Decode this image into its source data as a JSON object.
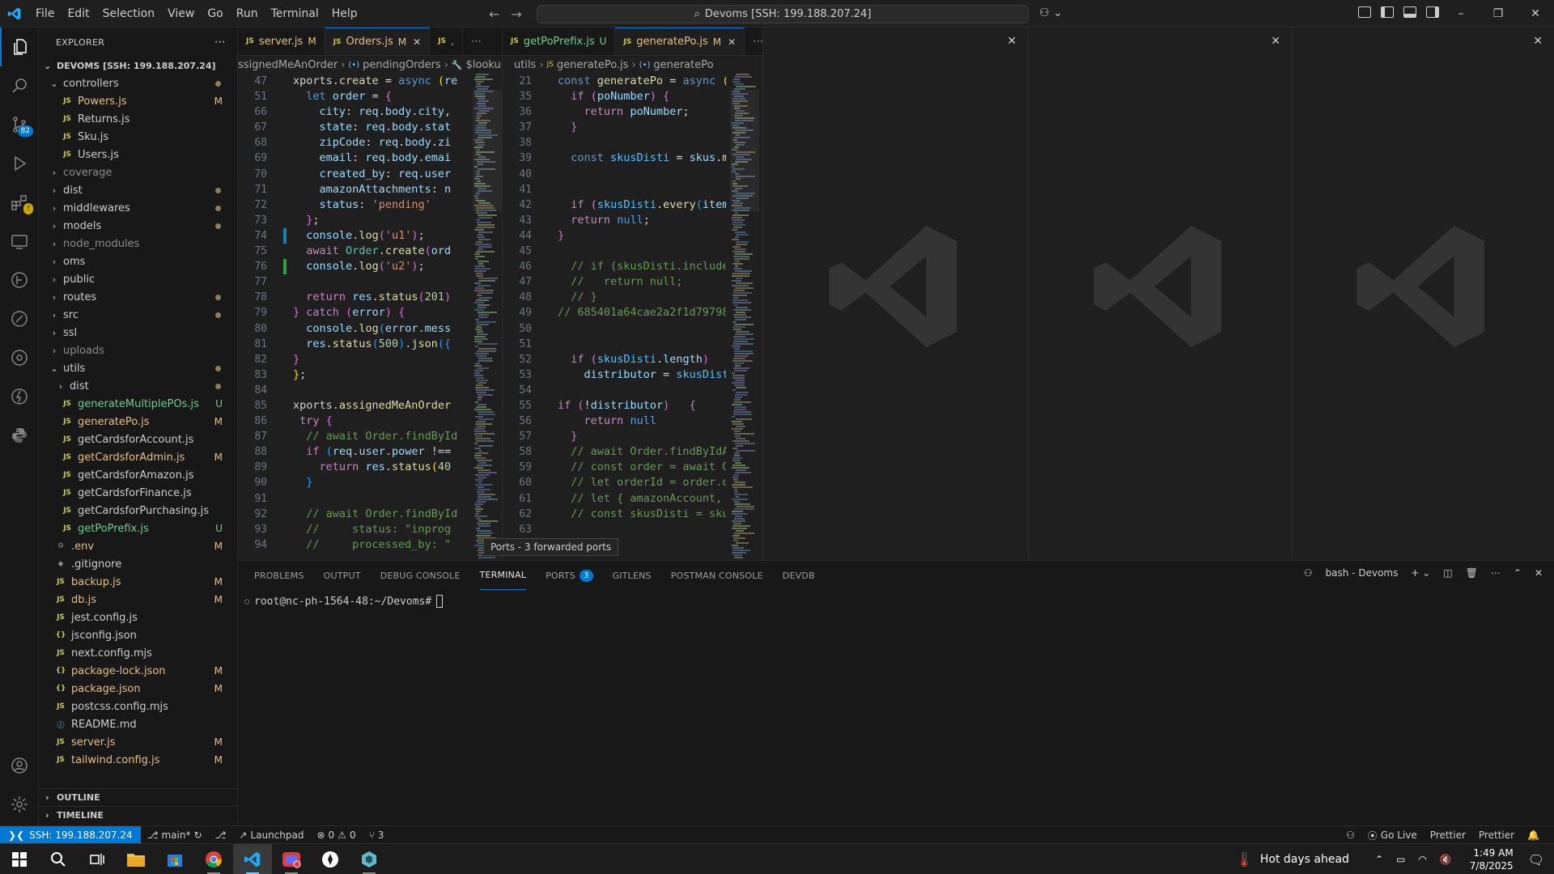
{
  "titlebar": {
    "menu": [
      "File",
      "Edit",
      "Selection",
      "View",
      "Go",
      "Run",
      "Terminal",
      "Help"
    ],
    "search_text": "Devoms [SSH: 199.188.207.24]"
  },
  "sidebar": {
    "header": "EXPLORER",
    "workspace": "DEVOMS [SSH: 199.188.207.24]",
    "items": [
      {
        "label": "controllers",
        "type": "folder-open",
        "indent": 1,
        "dot": true
      },
      {
        "label": "Powers.js",
        "type": "js",
        "indent": 2,
        "status": "M"
      },
      {
        "label": "Returns.js",
        "type": "js",
        "indent": 2
      },
      {
        "label": "Sku.js",
        "type": "js",
        "indent": 2
      },
      {
        "label": "Users.js",
        "type": "js",
        "indent": 2
      },
      {
        "label": "coverage",
        "type": "folder",
        "indent": 1,
        "ignored": true
      },
      {
        "label": "dist",
        "type": "folder",
        "indent": 1,
        "dot": true
      },
      {
        "label": "middlewares",
        "type": "folder",
        "indent": 1,
        "dot": true
      },
      {
        "label": "models",
        "type": "folder",
        "indent": 1,
        "dot": true
      },
      {
        "label": "node_modules",
        "type": "folder",
        "indent": 1,
        "ignored": true
      },
      {
        "label": "oms",
        "type": "folder",
        "indent": 1
      },
      {
        "label": "public",
        "type": "folder",
        "indent": 1
      },
      {
        "label": "routes",
        "type": "folder",
        "indent": 1,
        "dot": true
      },
      {
        "label": "src",
        "type": "folder",
        "indent": 1,
        "dot": true
      },
      {
        "label": "ssl",
        "type": "folder",
        "indent": 1
      },
      {
        "label": "uploads",
        "type": "folder",
        "indent": 1,
        "ignored": true
      },
      {
        "label": "utils",
        "type": "folder-open",
        "indent": 1,
        "dot": true
      },
      {
        "label": "dist",
        "type": "folder",
        "indent": 2,
        "dot": true
      },
      {
        "label": "generateMultiplePOs.js",
        "type": "js",
        "indent": 2,
        "status": "U"
      },
      {
        "label": "generatePo.js",
        "type": "js",
        "indent": 2,
        "status": "M"
      },
      {
        "label": "getCardsforAccount.js",
        "type": "js",
        "indent": 2
      },
      {
        "label": "getCardsforAdmin.js",
        "type": "js",
        "indent": 2,
        "status": "M"
      },
      {
        "label": "getCardsforAmazon.js",
        "type": "js",
        "indent": 2
      },
      {
        "label": "getCardsforFinance.js",
        "type": "js",
        "indent": 2
      },
      {
        "label": "getCardsforPurchasing.js",
        "type": "js",
        "indent": 2
      },
      {
        "label": "getPoPrefix.js",
        "type": "js",
        "indent": 2,
        "status": "U"
      },
      {
        "label": ".env",
        "type": "gear",
        "indent": 1,
        "status": "M"
      },
      {
        "label": ".gitignore",
        "type": "git",
        "indent": 1
      },
      {
        "label": "backup.js",
        "type": "js",
        "indent": 1,
        "status": "M"
      },
      {
        "label": "db.js",
        "type": "js",
        "indent": 1,
        "status": "M"
      },
      {
        "label": "jest.config.js",
        "type": "js",
        "indent": 1
      },
      {
        "label": "jsconfig.json",
        "type": "json",
        "indent": 1
      },
      {
        "label": "next.config.mjs",
        "type": "js",
        "indent": 1
      },
      {
        "label": "package-lock.json",
        "type": "json",
        "indent": 1,
        "status": "M"
      },
      {
        "label": "package.json",
        "type": "json",
        "indent": 1,
        "status": "M"
      },
      {
        "label": "postcss.config.mjs",
        "type": "js",
        "indent": 1
      },
      {
        "label": "README.md",
        "type": "info",
        "indent": 1
      },
      {
        "label": "server.js",
        "type": "js",
        "indent": 1,
        "status": "M"
      },
      {
        "label": "tailwind.config.js",
        "type": "js",
        "indent": 1,
        "status": "M"
      }
    ],
    "outline": "OUTLINE",
    "timeline": "TIMELINE"
  },
  "editor1": {
    "tabs": [
      {
        "label": "server.js",
        "status": "M"
      },
      {
        "label": "Orders.js",
        "status": "M",
        "active": true
      },
      {
        "label": ",",
        "status": ""
      }
    ],
    "breadcrumb": [
      "ssignedMeAnOrder",
      "pendingOrders",
      "$lookup"
    ],
    "lines": [
      {
        "n": "47",
        "html": "<span class='pl'>xports.</span><span class='fn'>create</span><span class='pl'> = </span><span class='kw'>async</span><span class='pl'> </span><span class='br'>(</span><span class='vr'>re</span>",
        "gut": ""
      },
      {
        "n": "51",
        "html": "<span class='pl'>  </span><span class='kw'>let</span><span class='pl'> </span><span class='vr'>order</span><span class='pl'> = </span><span class='br2'>{</span>",
        "gut": ""
      },
      {
        "n": "66",
        "html": "<span class='pl'>    </span><span class='vr'>city</span><span class='pl'>: </span><span class='vr'>req</span><span class='pl'>.</span><span class='vr'>body</span><span class='pl'>.</span><span class='vr'>city</span><span class='pl'>,</span>",
        "gut": ""
      },
      {
        "n": "67",
        "html": "<span class='pl'>    </span><span class='vr'>state</span><span class='pl'>: </span><span class='vr'>req</span><span class='pl'>.</span><span class='vr'>body</span><span class='pl'>.</span><span class='vr'>stat</span>",
        "gut": ""
      },
      {
        "n": "68",
        "html": "<span class='pl'>    </span><span class='vr'>zipCode</span><span class='pl'>: </span><span class='vr'>req</span><span class='pl'>.</span><span class='vr'>body</span><span class='pl'>.</span><span class='vr'>zi</span>",
        "gut": ""
      },
      {
        "n": "69",
        "html": "<span class='pl'>    </span><span class='vr'>email</span><span class='pl'>: </span><span class='vr'>req</span><span class='pl'>.</span><span class='vr'>body</span><span class='pl'>.</span><span class='vr'>emai</span>",
        "gut": ""
      },
      {
        "n": "70",
        "html": "<span class='pl'>    </span><span class='vr'>created_by</span><span class='pl'>: </span><span class='vr'>req</span><span class='pl'>.</span><span class='vr'>user</span>",
        "gut": ""
      },
      {
        "n": "71",
        "html": "<span class='pl'>    </span><span class='vr'>amazonAttachments</span><span class='pl'>: </span><span class='vr'>n</span>",
        "gut": ""
      },
      {
        "n": "72",
        "html": "<span class='pl'>    </span><span class='vr'>status</span><span class='pl'>: </span><span class='str'>'pending'</span>",
        "gut": ""
      },
      {
        "n": "73",
        "html": "<span class='pl'>  </span><span class='br2'>}</span><span class='pl'>;</span>",
        "gut": ""
      },
      {
        "n": "74",
        "html": "<span class='pl'>  </span><span class='vr'>console</span><span class='pl'>.</span><span class='fn'>log</span><span class='br2'>(</span><span class='str'>'u1'</span><span class='br2'>)</span><span class='pl'>;</span>",
        "gut": "b"
      },
      {
        "n": "75",
        "html": "<span class='pl'>  </span><span class='kw2'>await</span><span class='pl'> </span><span class='ty'>Order</span><span class='pl'>.</span><span class='fn'>create</span><span class='br2'>(</span><span class='vr'>ord</span>",
        "gut": ""
      },
      {
        "n": "76",
        "html": "<span class='pl'>  </span><span class='vr'>console</span><span class='pl'>.</span><span class='fn'>log</span><span class='br2'>(</span><span class='str'>'u2'</span><span class='br2'>)</span><span class='pl'>;</span>",
        "gut": "g"
      },
      {
        "n": "77",
        "html": "",
        "gut": ""
      },
      {
        "n": "78",
        "html": "<span class='pl'>  </span><span class='kw2'>return</span><span class='pl'> </span><span class='vr'>res</span><span class='pl'>.</span><span class='fn'>status</span><span class='br2'>(</span><span class='num'>201</span><span class='br2'>)</span>",
        "gut": ""
      },
      {
        "n": "79",
        "html": "<span class='br2'>}</span><span class='pl'> </span><span class='kw2'>catch</span><span class='pl'> </span><span class='br2'>(</span><span class='vr'>error</span><span class='br2'>)</span><span class='pl'> </span><span class='br2'>{</span>",
        "gut": ""
      },
      {
        "n": "80",
        "html": "<span class='pl'>  </span><span class='vr'>console</span><span class='pl'>.</span><span class='fn'>log</span><span class='br3'>(</span><span class='vr'>error</span><span class='pl'>.</span><span class='vr'>mess</span>",
        "gut": ""
      },
      {
        "n": "81",
        "html": "<span class='pl'>  </span><span class='vr'>res</span><span class='pl'>.</span><span class='fn'>status</span><span class='br3'>(</span><span class='num'>500</span><span class='br3'>)</span><span class='pl'>.</span><span class='fn'>json</span><span class='br3'>({</span>",
        "gut": ""
      },
      {
        "n": "82",
        "html": "<span class='br2'>}</span>",
        "gut": ""
      },
      {
        "n": "83",
        "html": "<span class='br'>}</span><span class='pl'>;</span>",
        "gut": ""
      },
      {
        "n": "84",
        "html": "",
        "gut": ""
      },
      {
        "n": "85",
        "html": "<span class='pl'>xports.</span><span class='fn'>assignedMeAnOrder</span>",
        "gut": ""
      },
      {
        "n": "86",
        "html": "<span class='pl'> </span><span class='kw2'>try</span><span class='pl'> </span><span class='br2'>{</span>",
        "gut": ""
      },
      {
        "n": "87",
        "html": "<span class='pl'>  </span><span class='cm'>// await Order.findById</span>",
        "gut": ""
      },
      {
        "n": "88",
        "html": "<span class='pl'>  </span><span class='kw2'>if</span><span class='pl'> </span><span class='br3'>(</span><span class='vr'>req</span><span class='pl'>.</span><span class='vr'>user</span><span class='pl'>.</span><span class='vr'>power</span><span class='pl'> !==</span>",
        "gut": ""
      },
      {
        "n": "89",
        "html": "<span class='pl'>    </span><span class='kw2'>return</span><span class='pl'> </span><span class='vr'>res</span><span class='pl'>.</span><span class='fn'>status</span><span class='br'>(</span><span class='num'>40</span>",
        "gut": ""
      },
      {
        "n": "90",
        "html": "<span class='pl'>  </span><span class='br3'>}</span>",
        "gut": ""
      },
      {
        "n": "91",
        "html": "",
        "gut": ""
      },
      {
        "n": "92",
        "html": "<span class='pl'>  </span><span class='cm'>// await Order.findById</span>",
        "gut": ""
      },
      {
        "n": "93",
        "html": "<span class='pl'>  </span><span class='cm'>//     status: \"inprog</span>",
        "gut": ""
      },
      {
        "n": "94",
        "html": "<span class='pl'>  </span><span class='cm'>//     processed_by: \"</span>",
        "gut": ""
      }
    ]
  },
  "editor2": {
    "tabs": [
      {
        "label": "getPoPrefix.js",
        "status": "U"
      },
      {
        "label": "generatePo.js",
        "status": "M",
        "active": true
      }
    ],
    "breadcrumb": [
      "utils",
      "generatePo.js",
      "generatePo"
    ],
    "lines": [
      {
        "n": "21",
        "html": "<span class='kw'>const</span><span class='pl'> </span><span class='fn'>generatePo</span><span class='pl'> = </span><span class='kw'>async</span><span class='pl'> </span><span class='br'>(</span><span class='vr'>c</span>",
        "gut": ""
      },
      {
        "n": "35",
        "html": "<span class='pl'>  </span><span class='kw2'>if</span><span class='pl'> </span><span class='br2'>(</span><span class='vr'>poNumber</span><span class='br2'>)</span><span class='pl'> </span><span class='br2'>{</span>",
        "gut": ""
      },
      {
        "n": "36",
        "html": "<span class='pl'>    </span><span class='kw2'>return</span><span class='pl'> </span><span class='vr'>poNumber</span><span class='pl'>;</span>",
        "gut": ""
      },
      {
        "n": "37",
        "html": "<span class='pl'>  </span><span class='br2'>}</span>",
        "gut": ""
      },
      {
        "n": "38",
        "html": "",
        "gut": ""
      },
      {
        "n": "39",
        "html": "<span class='pl'>  </span><span class='kw'>const</span><span class='pl'> </span><span class='cn'>skusDisti</span><span class='pl'> = </span><span class='vr'>skus</span><span class='pl'>.</span><span class='fn'>ma</span>",
        "gut": ""
      },
      {
        "n": "40",
        "html": "",
        "gut": ""
      },
      {
        "n": "41",
        "html": "",
        "gut": ""
      },
      {
        "n": "42",
        "html": "<span class='pl'>  </span><span class='kw2'>if</span><span class='pl'> </span><span class='br2'>(</span><span class='cn'>skusDisti</span><span class='pl'>.</span><span class='fn'>every</span><span class='br3'>(</span><span class='vr'>item</span>",
        "gut": ""
      },
      {
        "n": "43",
        "html": "<span class='pl'>  </span><span class='kw2'>return</span><span class='pl'> </span><span class='kw'>null</span><span class='pl'>;</span>",
        "gut": ""
      },
      {
        "n": "44",
        "html": "<span class='br2'>}</span>",
        "gut": ""
      },
      {
        "n": "45",
        "html": "",
        "gut": ""
      },
      {
        "n": "46",
        "html": "<span class='pl'>  </span><span class='cm'>// if (skusDisti.includes</span>",
        "gut": ""
      },
      {
        "n": "47",
        "html": "<span class='pl'>  </span><span class='cm'>//   return null;</span>",
        "gut": ""
      },
      {
        "n": "48",
        "html": "<span class='pl'>  </span><span class='cm'>// }</span>",
        "gut": ""
      },
      {
        "n": "49",
        "html": "<span class='cm'>// 685401a64cae2a2f1d79798</span>",
        "gut": ""
      },
      {
        "n": "50",
        "html": "",
        "gut": ""
      },
      {
        "n": "51",
        "html": "",
        "gut": ""
      },
      {
        "n": "52",
        "html": "<span class='pl'>  </span><span class='kw2'>if</span><span class='pl'> </span><span class='br2'>(</span><span class='cn'>skusDisti</span><span class='pl'>.</span><span class='vr'>length</span><span class='br2'>)</span>",
        "gut": ""
      },
      {
        "n": "53",
        "html": "<span class='pl'>    </span><span class='vr'>distributor</span><span class='pl'> = </span><span class='cn'>skusDisti</span>",
        "gut": ""
      },
      {
        "n": "54",
        "html": "",
        "gut": ""
      },
      {
        "n": "55",
        "html": "<span class='kw2'>if</span><span class='pl'> </span><span class='br2'>(</span><span class='pl'>!</span><span class='vr'>distributor</span><span class='br2'>)</span><span class='pl'>   </span><span class='br2'>{</span>",
        "gut": ""
      },
      {
        "n": "56",
        "html": "<span class='pl'>    </span><span class='kw2'>return</span><span class='pl'> </span><span class='kw'>null</span>",
        "gut": ""
      },
      {
        "n": "57",
        "html": "<span class='pl'>  </span><span class='br2'>}</span>",
        "gut": ""
      },
      {
        "n": "58",
        "html": "<span class='pl'>  </span><span class='cm'>// await Order.findByIdAn</span>",
        "gut": ""
      },
      {
        "n": "59",
        "html": "<span class='pl'>  </span><span class='cm'>// const order = await Or</span>",
        "gut": ""
      },
      {
        "n": "60",
        "html": "<span class='pl'>  </span><span class='cm'>// let orderId = order.or</span>",
        "gut": ""
      },
      {
        "n": "61",
        "html": "<span class='pl'>  </span><span class='cm'>// let { amazonAccount, s</span>",
        "gut": ""
      },
      {
        "n": "62",
        "html": "<span class='pl'>  </span><span class='cm'>// const skusDisti = skus</span>",
        "gut": ""
      },
      {
        "n": "63",
        "html": "",
        "gut": ""
      }
    ]
  },
  "tooltip": "Ports - 3 forwarded ports",
  "panel": {
    "tabs": [
      "PROBLEMS",
      "OUTPUT",
      "DEBUG CONSOLE",
      "TERMINAL",
      "PORTS",
      "GITLENS",
      "POSTMAN CONSOLE",
      "DEVDB"
    ],
    "active_tab": "TERMINAL",
    "ports_count": "3",
    "terminal_name": "bash - Devoms",
    "prompt": "root@nc-ph-1564-48:~/Devoms#"
  },
  "statusbar": {
    "remote": "SSH: 199.188.207.24",
    "branch": "main*",
    "launchpad": "Launchpad",
    "errors": "0",
    "warnings": "0",
    "ports": "3",
    "golive": "Go Live",
    "prettier1": "Prettier",
    "prettier2": "Prettier"
  },
  "taskbar": {
    "weather": "Hot days ahead",
    "time": "1:49 AM",
    "date": "7/8/2025"
  },
  "badges": {
    "scm": "82"
  }
}
